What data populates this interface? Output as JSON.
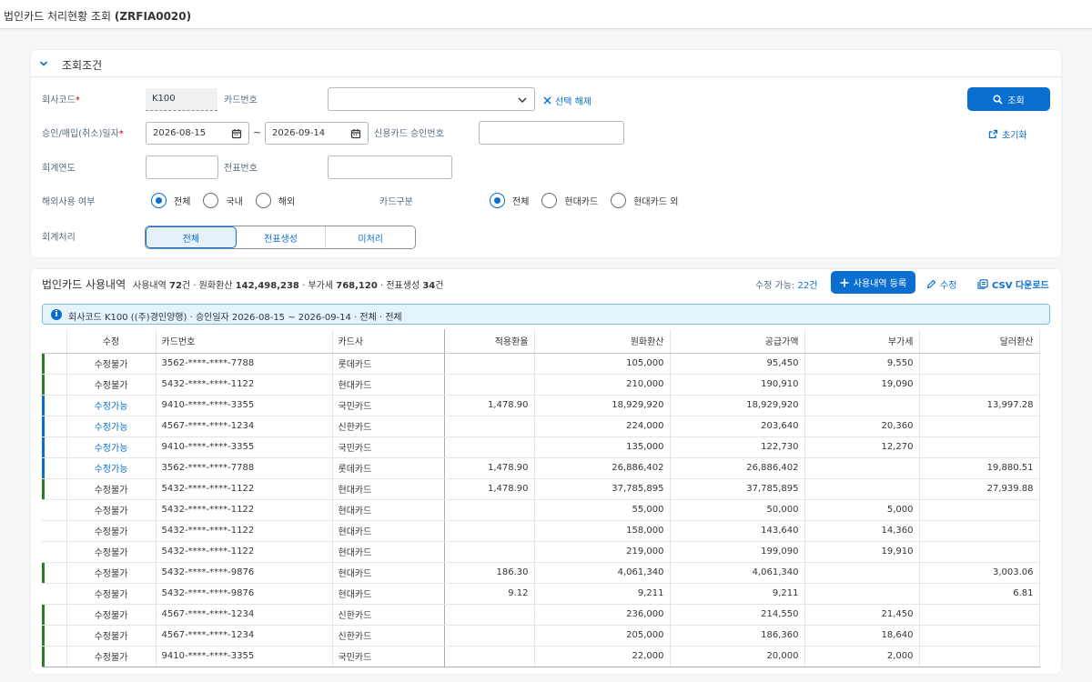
{
  "app": {
    "title_prefix": "법인카드 처리현황 조회",
    "title_code": "(ZRFIA0020)"
  },
  "filter": {
    "section_title": "조회조건",
    "company_code_label": "회사코드",
    "company_code_value": "K100",
    "card_no_label": "카드번호",
    "card_no_value": "",
    "clear_selection_label": "선택 해제",
    "search_button_label": "조회",
    "reset_label": "초기화",
    "approval_date_label": "승인/매입(취소)일자",
    "date_from": "2026-08-15",
    "date_to": "2026-09-14",
    "tilde": "~",
    "approval_no_label": "신용카드 승인번호",
    "approval_no_value": "",
    "fiscal_year_label": "회계연도",
    "fiscal_year_value": "",
    "doc_no_label": "전표번호",
    "doc_no_value": "",
    "overseas_label": "해외사용 여부",
    "overseas_options": [
      "전체",
      "국내",
      "해외"
    ],
    "overseas_selected": "전체",
    "card_type_label": "카드구분",
    "card_type_options": [
      "전체",
      "현대카드",
      "현대카드 외"
    ],
    "card_type_selected": "전체",
    "accounting_label": "회계처리",
    "accounting_options": [
      "전체",
      "전표생성",
      "미처리"
    ],
    "accounting_selected": "전체"
  },
  "usage": {
    "title": "법인카드 사용내역",
    "summary_prefix": "사용내역",
    "count": "72",
    "count_unit": "건",
    "krw_label": "원화환산",
    "krw_total": "142,498,238",
    "vat_label": "부가세",
    "vat_total": "768,120",
    "doc_label": "전표생성",
    "doc_count": "34",
    "doc_unit": "건",
    "editable_label": "수정 가능:",
    "editable_value": "22건",
    "add_button_label": "사용내역 등록",
    "edit_label": "수정",
    "csv_label": "CSV 다운로드",
    "info_text": "회사코드 K100 ((주)경인양행) · 승인일자 2026-08-15 ~ 2026-09-14 · 전체 · 전체",
    "columns": [
      "수정",
      "카드번호",
      "카드사",
      "적용환율",
      "원화환산",
      "공급가액",
      "부가세",
      "달러환산"
    ],
    "rows": [
      {
        "mark": "green",
        "edit": "수정불가",
        "card": "3562-****-****-7788",
        "issuer": "롯데카드",
        "rate": "",
        "krw": "105,000",
        "supply": "95,450",
        "vat": "9,550",
        "usd": ""
      },
      {
        "mark": "green",
        "edit": "수정불가",
        "card": "5432-****-****-1122",
        "issuer": "현대카드",
        "rate": "",
        "krw": "210,000",
        "supply": "190,910",
        "vat": "19,090",
        "usd": ""
      },
      {
        "mark": "blue",
        "edit": "수정가능",
        "card": "9410-****-****-3355",
        "issuer": "국민카드",
        "rate": "1,478.90",
        "krw": "18,929,920",
        "supply": "18,929,920",
        "vat": "",
        "usd": "13,997.28"
      },
      {
        "mark": "blue",
        "edit": "수정가능",
        "card": "4567-****-****-1234",
        "issuer": "신한카드",
        "rate": "",
        "krw": "224,000",
        "supply": "203,640",
        "vat": "20,360",
        "usd": ""
      },
      {
        "mark": "blue",
        "edit": "수정가능",
        "card": "9410-****-****-3355",
        "issuer": "국민카드",
        "rate": "",
        "krw": "135,000",
        "supply": "122,730",
        "vat": "12,270",
        "usd": ""
      },
      {
        "mark": "blue",
        "edit": "수정가능",
        "card": "3562-****-****-7788",
        "issuer": "롯데카드",
        "rate": "1,478.90",
        "krw": "26,886,402",
        "supply": "26,886,402",
        "vat": "",
        "usd": "19,880.51"
      },
      {
        "mark": "green",
        "edit": "수정불가",
        "card": "5432-****-****-1122",
        "issuer": "현대카드",
        "rate": "1,478.90",
        "krw": "37,785,895",
        "supply": "37,785,895",
        "vat": "",
        "usd": "27,939.88"
      },
      {
        "mark": "",
        "edit": "수정불가",
        "card": "5432-****-****-1122",
        "issuer": "현대카드",
        "rate": "",
        "krw": "55,000",
        "supply": "50,000",
        "vat": "5,000",
        "usd": ""
      },
      {
        "mark": "",
        "edit": "수정불가",
        "card": "5432-****-****-1122",
        "issuer": "현대카드",
        "rate": "",
        "krw": "158,000",
        "supply": "143,640",
        "vat": "14,360",
        "usd": ""
      },
      {
        "mark": "",
        "edit": "수정불가",
        "card": "5432-****-****-1122",
        "issuer": "현대카드",
        "rate": "",
        "krw": "219,000",
        "supply": "199,090",
        "vat": "19,910",
        "usd": ""
      },
      {
        "mark": "green",
        "edit": "수정불가",
        "card": "5432-****-****-9876",
        "issuer": "현대카드",
        "rate": "186.30",
        "krw": "4,061,340",
        "supply": "4,061,340",
        "vat": "",
        "usd": "3,003.06"
      },
      {
        "mark": "",
        "edit": "수정불가",
        "card": "5432-****-****-9876",
        "issuer": "현대카드",
        "rate": "9.12",
        "krw": "9,211",
        "supply": "9,211",
        "vat": "",
        "usd": "6.81"
      },
      {
        "mark": "green",
        "edit": "수정불가",
        "card": "4567-****-****-1234",
        "issuer": "신한카드",
        "rate": "",
        "krw": "236,000",
        "supply": "214,550",
        "vat": "21,450",
        "usd": ""
      },
      {
        "mark": "green",
        "edit": "수정불가",
        "card": "4567-****-****-1234",
        "issuer": "신한카드",
        "rate": "",
        "krw": "205,000",
        "supply": "186,360",
        "vat": "18,640",
        "usd": ""
      },
      {
        "mark": "green",
        "edit": "수정불가",
        "card": "9410-****-****-3355",
        "issuer": "국민카드",
        "rate": "",
        "krw": "22,000",
        "supply": "20,000",
        "vat": "2,000",
        "usd": ""
      }
    ]
  },
  "colors": {
    "accent": "#0a6ed1",
    "mark_green": "#2b7d2b",
    "mark_blue": "#0a6ed1"
  }
}
